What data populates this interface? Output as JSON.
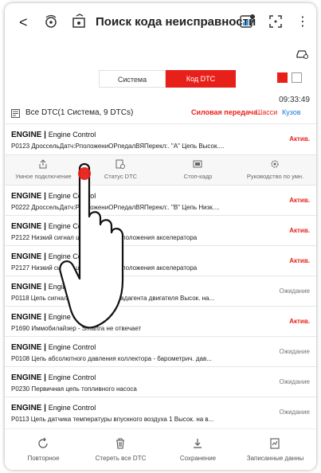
{
  "header": {
    "back_label": "<",
    "title": "Поиск кода неисправности",
    "more_label": "⋮"
  },
  "tabs": [
    {
      "label": "Система"
    },
    {
      "label": "Код DTC"
    }
  ],
  "timestamp": "09:33:49",
  "filter": {
    "label": "Все DTC(1 Система, 9 DTCs)",
    "categories": [
      "Силовая передача",
      "Шасси",
      "Кузов"
    ]
  },
  "rows": [
    {
      "system": "ENGINE",
      "sub": "Engine Control",
      "desc": "P0123 ДроссельДатч:РположениОРпедалВЯПерекл:. \"A\" Цепь Высок....",
      "status": "Актив."
    },
    {
      "system": "ENGINE",
      "sub": "Engine Control",
      "desc": "P0222 ДроссельДатч:РположениОРпедалВЯПерекл:. \"B\" Цепь Низк....",
      "status": "Актив."
    },
    {
      "system": "ENGINE",
      "sub": "Engine Control",
      "desc": "P2122 Низкий сигнал цепи датчика 1 положения акселератора",
      "status": "Актив."
    },
    {
      "system": "ENGINE",
      "sub": "Engine Control",
      "desc": "P2127 Низкий сигнал цепи датчика 2 положения акселератора",
      "status": "Актив."
    },
    {
      "system": "ENGINE",
      "sub": "Engine Control",
      "desc": "P0118 Цепь сигнала температуры хладагента двигателя Высок. на...",
      "status": "Ожидание"
    },
    {
      "system": "ENGINE",
      "sub": "Engine Control",
      "desc": "P1690 Иммобилайзер - Smartra не отвечает",
      "status": "Актив."
    },
    {
      "system": "ENGINE",
      "sub": "Engine Control",
      "desc": "P0108 Цепь абсолютного давления коллектора - барометрич. дав...",
      "status": "Ожидание"
    },
    {
      "system": "ENGINE",
      "sub": "Engine Control",
      "desc": "P0230 Первичная цепь топливного насоса",
      "status": "Ожидание"
    },
    {
      "system": "ENGINE",
      "sub": "Engine Control",
      "desc": "P0113 Цепь датчика температуры впускного воздуха 1 Высок. на в...",
      "status": "Ожидание"
    }
  ],
  "actions": [
    {
      "label": "Умное подключение",
      "icon": "share-icon"
    },
    {
      "label": "Статус DTC",
      "icon": "status-icon"
    },
    {
      "label": "Стоп-кадр",
      "icon": "freeze-frame-icon"
    },
    {
      "label": "Руководство по умн.",
      "icon": "gear-icon"
    }
  ],
  "bottom": [
    {
      "label": "Повторное",
      "icon": "refresh-icon"
    },
    {
      "label": "Стереть все DTC",
      "icon": "trash-icon"
    },
    {
      "label": "Сохранение",
      "icon": "download-icon"
    },
    {
      "label": "Записанные данны",
      "icon": "record-icon"
    }
  ],
  "colors": {
    "accent": "#e8201a",
    "link": "#1a7ae0"
  }
}
